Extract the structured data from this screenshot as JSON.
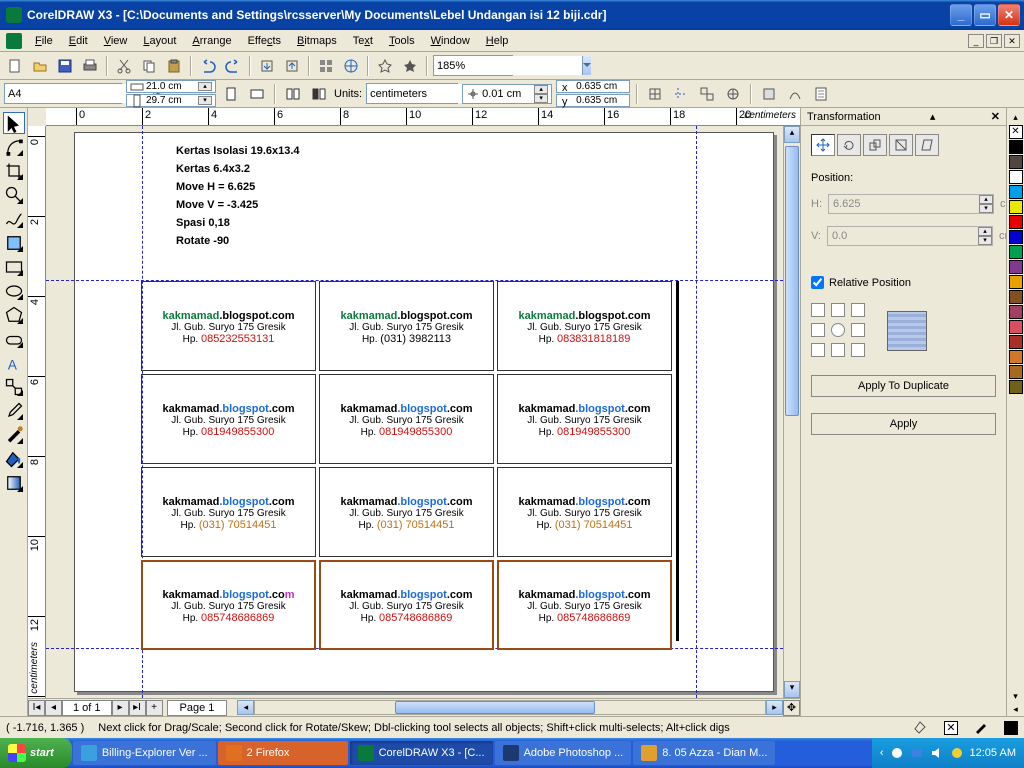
{
  "titlebar": {
    "title": "CorelDRAW X3 - [C:\\Documents and Settings\\rcsserver\\My Documents\\Lebel Undangan isi 12 biji.cdr]"
  },
  "menu": {
    "file": "File",
    "edit": "Edit",
    "view": "View",
    "layout": "Layout",
    "arrange": "Arrange",
    "effects": "Effects",
    "bitmaps": "Bitmaps",
    "text": "Text",
    "tools": "Tools",
    "window": "Window",
    "help": "Help"
  },
  "toolbar": {
    "zoom": "185%"
  },
  "propbar": {
    "paper": "A4",
    "width": "21.0 cm",
    "height": "29.7 cm",
    "units_label": "Units:",
    "units": "centimeters",
    "nudge": "0.01 cm",
    "dupx": "0.635 cm",
    "dupy": "0.635 cm"
  },
  "ruler_unit": "centimeters",
  "notes": {
    "l1": "Kertas Isolasi 19.6x13.4",
    "l2": "Kertas 6.4x3.2",
    "l3": "Move H = 6.625",
    "l4": "Move V = -3.425",
    "l5": "Spasi 0,18",
    "l6": "Rotate -90"
  },
  "cards": [
    [
      {
        "style": "g",
        "hp": "085232553131",
        "hc": "red"
      },
      {
        "style": "g",
        "hp": "(031) 3982113",
        "hc": "black"
      },
      {
        "style": "g",
        "hp": "083831818189",
        "hc": "red"
      }
    ],
    [
      {
        "style": "b",
        "hp": "081949855300",
        "hc": "red"
      },
      {
        "style": "b",
        "hp": "081949855300",
        "hc": "red"
      },
      {
        "style": "b",
        "hp": "081949855300",
        "hc": "red"
      }
    ],
    [
      {
        "style": "b",
        "hp": "(031) 70514451",
        "hc": "org"
      },
      {
        "style": "b",
        "hp": "(031) 70514451",
        "hc": "org"
      },
      {
        "style": "b",
        "hp": "(031) 70514451",
        "hc": "org"
      }
    ],
    [
      {
        "style": "m",
        "hp": "085748686869",
        "hc": "red",
        "brown": true
      },
      {
        "style": "b",
        "hp": "085748686869",
        "hc": "red",
        "brown": true
      },
      {
        "style": "b",
        "hp": "085748686869",
        "hc": "red",
        "brown": true
      }
    ]
  ],
  "card_common": {
    "domain": "kakmamad",
    "blog": ".blogspot",
    "com": ".com",
    "addr": "Jl. Gub. Suryo 175 Gresik",
    "hp_prefix": "Hp. "
  },
  "docker": {
    "title": "Transformation",
    "position_label": "Position:",
    "h_label": "H:",
    "h_value": "6.625",
    "v_label": "V:",
    "v_value": "0.0",
    "unit": "cm",
    "relative": "Relative Position",
    "apply_dup": "Apply To Duplicate",
    "apply": "Apply"
  },
  "pagenav": {
    "count": "1 of 1",
    "tab": "Page 1"
  },
  "status": {
    "coords": "( -1.716, 1.365 )",
    "hint": "Next click for Drag/Scale; Second click for Rotate/Skew; Dbl-clicking tool selects all objects; Shift+click multi-selects; Alt+click digs"
  },
  "taskbar": {
    "start": "start",
    "tasks": [
      {
        "label": "Billing-Explorer Ver ...",
        "cls": "blue",
        "color": "#3aa0e0"
      },
      {
        "label": "2 Firefox",
        "cls": "orange",
        "color": "#e07020"
      },
      {
        "label": "CorelDRAW X3 - [C...",
        "cls": "active",
        "color": "#0a7a3a"
      },
      {
        "label": "Adobe Photoshop ...",
        "cls": "blue",
        "color": "#1a3a70"
      },
      {
        "label": "8. 05 Azza - Dian M...",
        "cls": "blue",
        "color": "#e0a030"
      }
    ],
    "clock": "12:05 AM"
  },
  "palette": [
    "#000000",
    "#504840",
    "#ffffff",
    "#00a0e8",
    "#e8e800",
    "#e80000",
    "#0000d0",
    "#00a050",
    "#803890",
    "#e8a000",
    "#805020",
    "#a04060",
    "#d85060",
    "#a83028",
    "#d07828",
    "#a86820",
    "#706018"
  ]
}
